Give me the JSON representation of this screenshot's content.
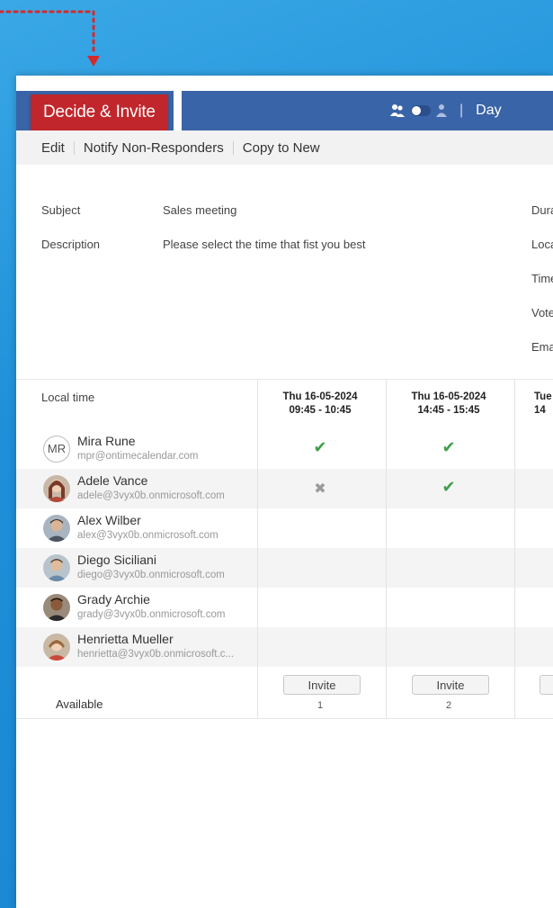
{
  "header": {
    "brand": "Decide & Invite",
    "view_label": "Day",
    "separator": "|"
  },
  "menu": {
    "items": [
      "Edit",
      "Notify Non-Responders",
      "Copy to New"
    ]
  },
  "details": {
    "subject_label": "Subject",
    "subject_value": "Sales meeting",
    "description_label": "Description",
    "description_value": "Please select the time that fist you best",
    "right_labels": [
      "Dura",
      "Loca",
      "Time",
      "Vote",
      "Ema"
    ]
  },
  "table": {
    "local_time_label": "Local time",
    "slots": [
      {
        "date": "Thu 16-05-2024",
        "time": "09:45 - 10:45",
        "invite": "Invite",
        "count": "1"
      },
      {
        "date": "Thu 16-05-2024",
        "time": "14:45 - 15:45",
        "invite": "Invite",
        "count": "2"
      },
      {
        "date": "Tue",
        "time": "14",
        "invite": "",
        "count": ""
      }
    ],
    "participants": [
      {
        "name": "Mira Rune",
        "email": "mpr@ontimecalendar.com",
        "initials": "MR",
        "votes": [
          "yes",
          "yes",
          ""
        ]
      },
      {
        "name": "Adele Vance",
        "email": "adele@3vyx0b.onmicrosoft.com",
        "initials": "",
        "votes": [
          "no",
          "yes",
          ""
        ]
      },
      {
        "name": "Alex Wilber",
        "email": "alex@3vyx0b.onmicrosoft.com",
        "initials": "",
        "votes": [
          "",
          "",
          ""
        ]
      },
      {
        "name": "Diego Siciliani",
        "email": "diego@3vyx0b.onmicrosoft.com",
        "initials": "",
        "votes": [
          "",
          "",
          ""
        ]
      },
      {
        "name": "Grady Archie",
        "email": "grady@3vyx0b.onmicrosoft.com",
        "initials": "",
        "votes": [
          "",
          "",
          ""
        ]
      },
      {
        "name": "Henrietta Mueller",
        "email": "henrietta@3vyx0b.onmicrosoft.c...",
        "initials": "",
        "votes": [
          "",
          "",
          ""
        ]
      }
    ],
    "available_label": "Available",
    "marks": {
      "yes": "✔",
      "no": "✖"
    }
  },
  "colors": {
    "brand_red": "#c0262c",
    "header_blue": "#3a64a8",
    "yes_green": "#3fa04a",
    "background_blue": "#1e8fd8"
  }
}
